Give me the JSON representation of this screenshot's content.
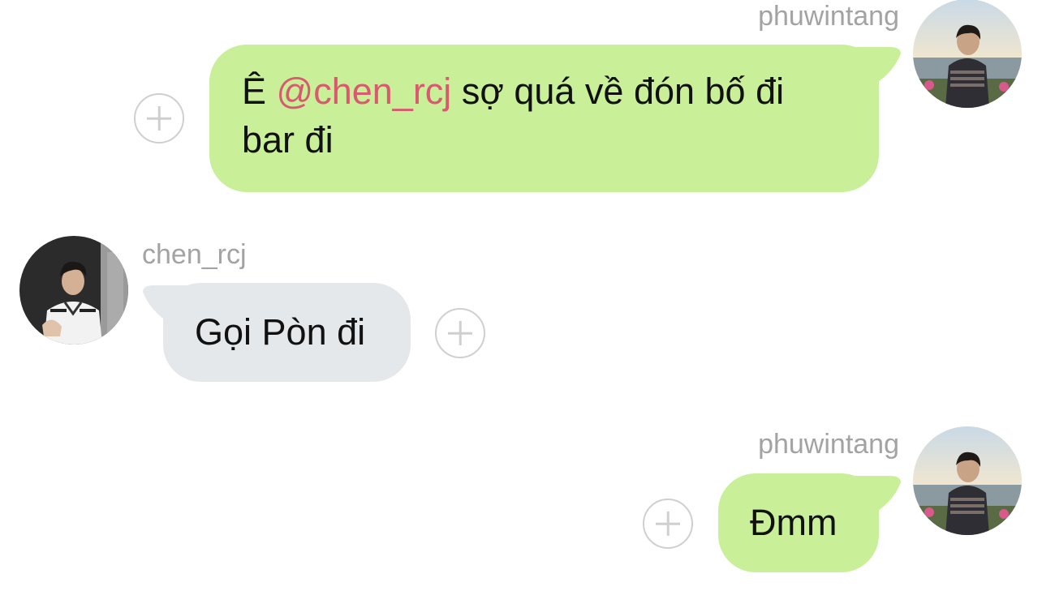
{
  "messages": [
    {
      "sender": "phuwintang",
      "direction": "outgoing",
      "text_before": "Ê ",
      "mention": "@chen_rcj",
      "text_after": " sợ quá về đón bố đi bar đi"
    },
    {
      "sender": "chen_rcj",
      "direction": "incoming",
      "text": "Gọi Pòn đi"
    },
    {
      "sender": "phuwintang",
      "direction": "outgoing",
      "text": "Đmm"
    }
  ],
  "colors": {
    "outgoing_bubble": "#c9f099",
    "incoming_bubble": "#e4e8eb",
    "mention": "#d9596e",
    "username": "#a3a3a3"
  }
}
